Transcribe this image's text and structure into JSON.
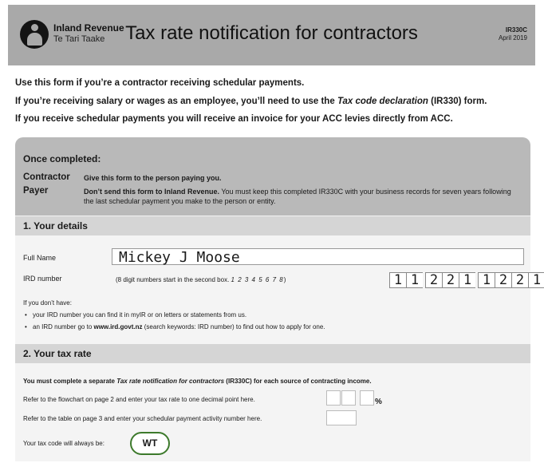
{
  "header": {
    "org_name": "Inland Revenue",
    "org_name_maori": "Te Tari Taake",
    "title": "Tax rate notification for contractors",
    "form_code": "IR330C",
    "form_date": "April 2019"
  },
  "intro": {
    "line1": "Use this form if you’re a contractor receiving schedular payments.",
    "line2_pre": "If you’re receiving salary or wages as an employee, you’ll need to use the ",
    "line2_em": "Tax code declaration",
    "line2_post": " (IR330) form.",
    "line3": "If you receive schedular payments you will receive an invoice for your ACC levies directly from ACC."
  },
  "once_completed": {
    "title": "Once completed:",
    "contractor_label": "Contractor",
    "contractor_text": "Give this form to the person paying you.",
    "payer_label": "Payer",
    "payer_bold": "Don’t send this form to Inland Revenue.",
    "payer_text": " You must keep this completed IR330C with your business records for seven years following the last schedular payment you make to the person or entity."
  },
  "details": {
    "heading": "1.  Your details",
    "full_name_label": "Full Name",
    "full_name_value": "Mickey J Moose",
    "ird_label": "IRD number",
    "ird_note_pre": "(8 digit numbers start in the second box.",
    "ird_note_example": "1 2 3 4 5 6 7 8",
    "ird_note_post": ")",
    "ird_digits": [
      "1",
      "1",
      "2",
      "2",
      "1",
      "1",
      "2",
      "2",
      "1"
    ],
    "dont_have": "If you don’t have:",
    "bullet1": "your IRD number you can find it in myIR or on letters or statements from us.",
    "bullet2_pre": "an IRD number go to ",
    "bullet2_link": "www.ird.govt.nz",
    "bullet2_post": " (search keywords: IRD number) to find out how to apply for one."
  },
  "tax_rate": {
    "heading": "2.  Your tax rate",
    "must_pre": "You must complete a separate ",
    "must_em": "Tax rate notification for contractors",
    "must_post": " (IR330C) for each source of contracting income.",
    "flowchart": "Refer to the flowchart on page 2 and enter your tax rate to one decimal point here.",
    "percent": "%",
    "table": "Refer to the table on page 3 and enter your schedular payment activity number here.",
    "tax_code_label": "Your tax code will always be:",
    "tax_code": "WT"
  },
  "colors": {
    "header_bg": "#a9a9a9",
    "once_bg": "#b9b9b9",
    "section_bg": "#d5d5d5",
    "wt_border": "#3d7a2c"
  }
}
